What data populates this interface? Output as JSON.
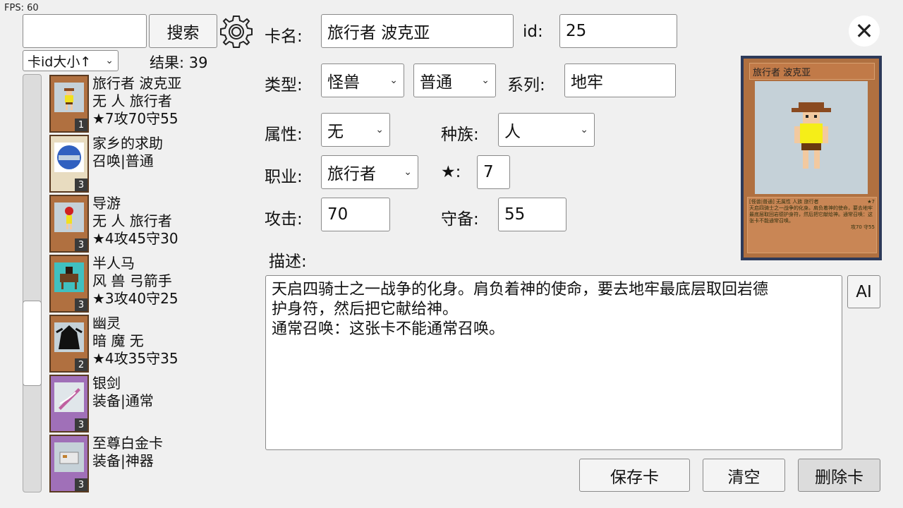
{
  "fps": "FPS: 60",
  "search": {
    "value": "",
    "button": "搜索"
  },
  "sort": {
    "selected": "卡id大小↑"
  },
  "result": {
    "text": "结果: 39"
  },
  "list": [
    {
      "lines": [
        "旅行者 波克亚",
        "无 人 旅行者",
        "★7攻70守55"
      ],
      "qty": "1",
      "bg": "#b07040"
    },
    {
      "lines": [
        "家乡的求助",
        "召唤|普通"
      ],
      "qty": "3",
      "bg": "#e8dcc0"
    },
    {
      "lines": [
        "导游",
        "无 人 旅行者",
        "★4攻45守30"
      ],
      "qty": "3",
      "bg": "#b07040"
    },
    {
      "lines": [
        "半人马",
        "风 兽 弓箭手",
        "★3攻40守25"
      ],
      "qty": "3",
      "bg": "#b07040"
    },
    {
      "lines": [
        "幽灵",
        "暗 魔 无",
        "★4攻35守35"
      ],
      "qty": "2",
      "bg": "#b07040"
    },
    {
      "lines": [
        "银剑",
        "装备|通常"
      ],
      "qty": "3",
      "bg": "#a070b8"
    },
    {
      "lines": [
        "至尊白金卡",
        "装备|神器"
      ],
      "qty": "3",
      "bg": "#a070b8"
    }
  ],
  "form": {
    "name_label": "卡名:",
    "name_value": "旅行者 波克亚",
    "id_label": "id:",
    "id_value": "25",
    "type_label": "类型:",
    "type_value": "怪兽",
    "subtype_value": "普通",
    "series_label": "系列:",
    "series_value": "地牢",
    "attr_label": "属性:",
    "attr_value": "无",
    "race_label": "种族:",
    "race_value": "人",
    "job_label": "职业:",
    "job_value": "旅行者",
    "star_label": "★:",
    "star_value": "7",
    "atk_label": "攻击:",
    "atk_value": "70",
    "def_label": "守备:",
    "def_value": "55",
    "desc_label": "描述:",
    "desc_value": "天启四骑士之一战争的化身。肩负着神的使命，要去地牢最底层取回岩德\n护身符，然后把它献给神。\n通常召唤：这张卡不能通常召唤。"
  },
  "buttons": {
    "ai": "AI",
    "save": "保存卡",
    "clear": "清空",
    "delete": "删除卡"
  },
  "preview": {
    "title": "旅行者 波克亚",
    "type_line": "[怪兽|普通] 无属性 人族 旅行者",
    "stars": "★7",
    "text": "天启四骑士之一战争的化身。肩负着神的使命，要去地牢最底层取回岩德护身符，然后把它献给神。通常召唤：这张卡不能通常召唤。",
    "stats": "攻70 守55"
  },
  "colors": {
    "card_frame": "#2d3a5a",
    "monster_bg": "#b07040",
    "equip_bg": "#a070b8"
  },
  "icons": {
    "settings": "gear-icon",
    "close": "close-icon"
  }
}
